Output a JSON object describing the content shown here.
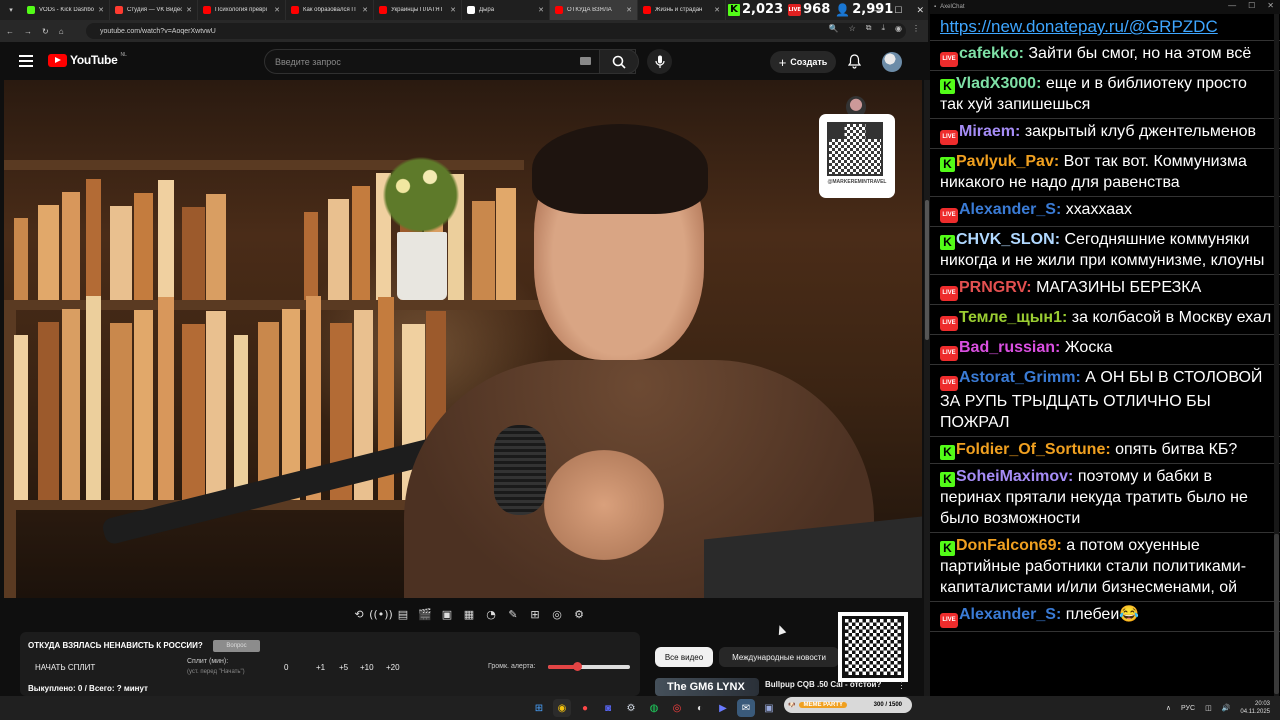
{
  "browser": {
    "tabs": [
      {
        "label": "VODs - Kick Dashbo",
        "color": "#53fc18",
        "active": false
      },
      {
        "label": "Студия — VK Видео",
        "color": "#ff3b30",
        "active": false
      },
      {
        "label": "Психология преврі",
        "color": "#ff0000",
        "active": false
      },
      {
        "label": "Как образовался П",
        "color": "#ff0000",
        "active": false
      },
      {
        "label": "Украинцы ПЛАТЯТ",
        "color": "#ff0000",
        "active": false
      },
      {
        "label": "Дыра",
        "color": "#ffffff",
        "active": false
      },
      {
        "label": "ОТКУДА ВЗЯЛА",
        "color": "#ff0000",
        "active": true
      },
      {
        "label": "Жизнь и страдан",
        "color": "#ff0000",
        "active": false
      }
    ],
    "url": "youtube.com/watch?v=AoqerXwtvwU"
  },
  "stream_stats": {
    "kick_viewers": "2,023",
    "live_viewers": "968",
    "total_viewers": "2,991"
  },
  "youtube": {
    "logo_text": "YouTube",
    "region": "NL",
    "search_placeholder": "Введите запрос",
    "create_label": "Создать",
    "overlay_handle": "@MARKEREMINTRAVEL",
    "chips": [
      "Все видео",
      "Международные новости"
    ],
    "rec_thumb_text": "The GM6 LYNX",
    "rec_title": "Bullpup CQB .50 Cal - отстой?"
  },
  "panel": {
    "title": "ОТКУДА ВЗЯЛАСЬ НЕНАВИСТЬ К РОССИИ?",
    "badge": "Вопрос",
    "start_split": "НАЧАТЬ СПЛИТ",
    "split_label": "Сплит (мин):",
    "split_sub": "(уст. перед \"Начать\")",
    "values": [
      "0",
      "+1",
      "+5",
      "+10",
      "+20"
    ],
    "alert_label": "Громк. алерта:",
    "alert_volume": 0.35,
    "bought": "Выкуплено: 0 / Всего: ? минут"
  },
  "chat": {
    "window_title": "AxelChat",
    "link": "https://new.donatepay.ru/@GRPZDC",
    "messages": [
      {
        "platform": "live",
        "name": "cafekko",
        "color": "#7ee0a6",
        "text": "Зайти бы смог, но на этом всё"
      },
      {
        "platform": "kick",
        "name": "VladX3000",
        "color": "#7ee0a6",
        "text": "еще и в библиотеку просто так хуй запишешься"
      },
      {
        "platform": "live",
        "name": "Miraem",
        "color": "#a58cf5",
        "text": "закрытый клуб джентельменов"
      },
      {
        "platform": "kick",
        "name": "Pavlyuk_Pav",
        "color": "#f0a020",
        "text": "Вот так вот. Коммунизма никакого не надо для равенства"
      },
      {
        "platform": "live",
        "name": "Alexander_S",
        "color": "#3a7bd5",
        "text": "ххаххаах"
      },
      {
        "platform": "kick",
        "name": "CHVK_SLON",
        "color": "#b0d8ff",
        "text": "Сегодняшние коммуняки никогда и не жили при коммунизме, клоуны"
      },
      {
        "platform": "live",
        "name": "PRNGRV",
        "color": "#e35050",
        "text": "МАГАЗИНЫ БЕРЕЗКА"
      },
      {
        "platform": "live",
        "name": "Темле_щын1",
        "color": "#9acd32",
        "text": "за колбасой в Москву ехал"
      },
      {
        "platform": "live",
        "name": "Bad_russian",
        "color": "#d94fe0",
        "text": "Жоска"
      },
      {
        "platform": "live",
        "name": "Astorat_Grimm",
        "color": "#3a7bd5",
        "text": "А ОН БЫ В СТОЛОВОЙ ЗА РУПЬ ТРЫДЦАТЬ ОТЛИЧНО БЫ ПОЖРАЛ"
      },
      {
        "platform": "kick",
        "name": "Foldier_Of_Sortune",
        "color": "#f0a020",
        "text": "опять битва КБ?"
      },
      {
        "platform": "kick",
        "name": "SoheiMaximov",
        "color": "#a58cf5",
        "text": "поэтому и бабки в перинах прятали некуда тратить было не было возможности"
      },
      {
        "platform": "kick",
        "name": "DonFalcon69",
        "color": "#f0a020",
        "text": "а потом охуенные партийные работники стали политиками-капиталистами и/или бизнесменами, ой"
      },
      {
        "platform": "live",
        "name": "Alexander_S",
        "color": "#3a7bd5",
        "text": "плебеи😂"
      }
    ]
  },
  "taskbar": {
    "meme_party_label": "MEME PARTY",
    "meme_party_count": "300 / 1500",
    "lang": "РУС",
    "time": "20:03",
    "date": "04.11.2025"
  }
}
